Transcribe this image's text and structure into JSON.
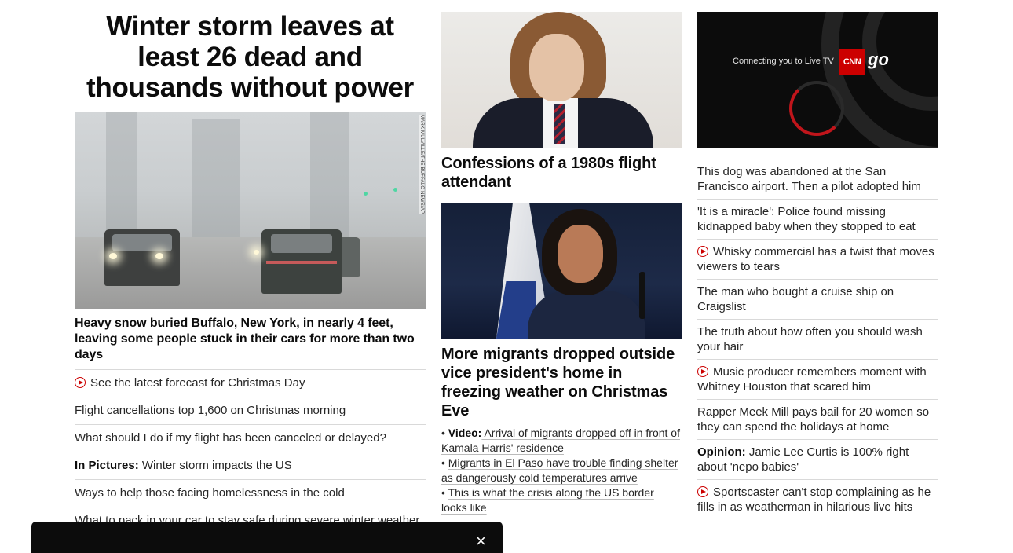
{
  "lead": {
    "headline": "Winter storm leaves at least 26 dead and thousands without power",
    "image_credit": "MARK MULVILLE/THE BUFFALO NEWS/AP",
    "caption": "Heavy snow buried Buffalo, New York, in nearly 4 feet, leaving some people stuck in their cars for more than two days",
    "links": [
      {
        "prefix": "",
        "text": "See the latest forecast for Christmas Day",
        "video": true
      },
      {
        "prefix": "",
        "text": "Flight cancellations top 1,600 on Christmas morning",
        "video": false
      },
      {
        "prefix": "",
        "text": "What should I do if my flight has been canceled or delayed?",
        "video": false
      },
      {
        "prefix": "In Pictures:",
        "text": " Winter storm impacts the US",
        "video": false
      },
      {
        "prefix": "",
        "text": "Ways to help those facing homelessness in the cold",
        "video": false
      },
      {
        "prefix": "",
        "text": "What to pack in your car to stay safe during severe winter weather",
        "video": false
      }
    ]
  },
  "middle": {
    "story1_title": "Confessions of a 1980s flight attendant",
    "story2_title": "More migrants dropped outside vice president's home in freezing weather on Christmas Eve",
    "bullets": [
      {
        "bullet": "•",
        "prefix": "Video:",
        "text": " Arrival of migrants dropped off in front of Kamala Harris' residence"
      },
      {
        "bullet": "•",
        "prefix": "",
        "text": "Migrants in El Paso have trouble finding shelter as dangerously cold temperatures arrive"
      },
      {
        "bullet": "•",
        "prefix": "",
        "text": "This is what the crisis along the US border looks like"
      }
    ]
  },
  "right": {
    "video": {
      "status": "Connecting you to Live TV",
      "logo": "CNN",
      "logo_suffix": "go"
    },
    "links": [
      {
        "prefix": "",
        "text": "This dog was abandoned at the San Francisco airport. Then a pilot adopted him",
        "video": false
      },
      {
        "prefix": "",
        "text": "'It is a miracle': Police found missing kidnapped baby when they stopped to eat",
        "video": false
      },
      {
        "prefix": "",
        "text": "Whisky commercial has a twist that moves viewers to tears",
        "video": true
      },
      {
        "prefix": "",
        "text": "The man who bought a cruise ship on Craigslist",
        "video": false
      },
      {
        "prefix": "",
        "text": "The truth about how often you should wash your hair",
        "video": false
      },
      {
        "prefix": "",
        "text": "Music producer remembers moment with Whitney Houston that scared him",
        "video": true
      },
      {
        "prefix": "",
        "text": "Rapper Meek Mill pays bail for 20 women so they can spend the holidays at home",
        "video": false
      },
      {
        "prefix": "Opinion:",
        "text": " Jamie Lee Curtis is 100% right about 'nepo babies'",
        "video": false
      },
      {
        "prefix": "",
        "text": "Sportscaster can't stop complaining as he fills in as weatherman in hilarious live hits",
        "video": true
      }
    ]
  },
  "bottom_bar": {
    "close_icon": "×"
  },
  "colors": {
    "accent": "#cc0000",
    "text": "#0c0c0c",
    "divider": "#d9d9d9"
  }
}
